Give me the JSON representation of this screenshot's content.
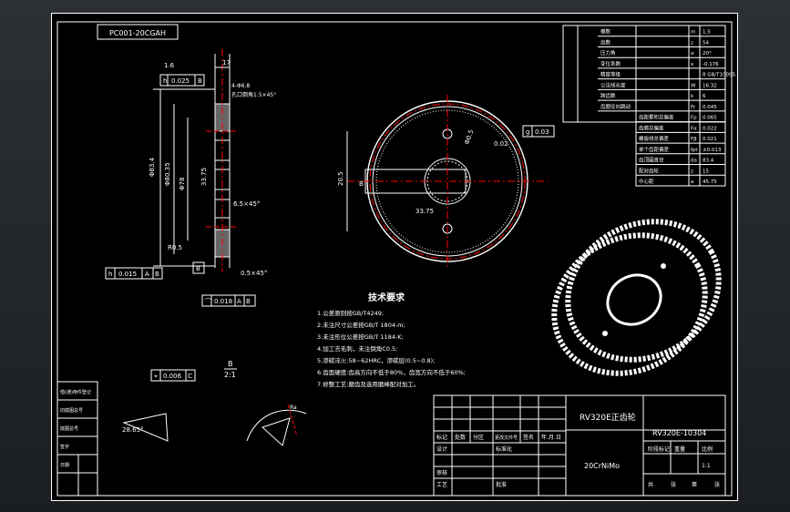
{
  "drawing_number_rotated": "PC001-20CGAH",
  "tech_requirements": {
    "title": "技术要求",
    "lines": [
      "1.公差原则按GB/T4249;",
      "2.未注尺寸公差按GB/T 1804-m;",
      "3.未注形位公差按GB/T 1184-K;",
      "4.加工去毛刺，未注倒角C0.5;",
      "5.渗碳淬火:58~62HRC，渗碳层(0.5~0.8);",
      "6.齿面硬度:齿高方向不低于80%，齿宽方向不低于60%;",
      "7.修整工艺:磨齿及选用磨棒配对加工。"
    ]
  },
  "title_block": {
    "part_name": "RV320E正齿轮",
    "drawing_code": "RV320E-10304",
    "material": "20CrNiMo",
    "scale": "1:1",
    "row_labels": [
      "标记",
      "处数",
      "分区",
      "更改文件号",
      "签名",
      "年.月.日"
    ],
    "labels": [
      "设计",
      "标准化",
      "审核",
      "工艺",
      "批准",
      "阶段标记",
      "重量",
      "比例"
    ],
    "sheets": [
      "共",
      "张",
      "第",
      "张"
    ]
  },
  "left_strip": [
    "借(通)用件登记",
    "旧底图总号",
    "底图总号",
    "签字",
    "日期"
  ],
  "gear_params": {
    "rows": [
      [
        "模数",
        "m",
        "1.5"
      ],
      [
        "齿数",
        "z",
        "54"
      ],
      [
        "压力角",
        "α",
        "20°"
      ],
      [
        "变位系数",
        "x",
        "-0.176"
      ],
      [
        "精度等级",
        "",
        "8 GB/T10095.1"
      ],
      [
        "公法线长度",
        "W",
        "16.32"
      ],
      [
        "跨齿数",
        "k",
        "6"
      ],
      [
        "齿圈径向跳动",
        "Fr",
        "0.045"
      ],
      [
        "齿距累积总偏差",
        "Fp",
        "0.065"
      ],
      [
        "齿廓总偏差",
        "Fα",
        "0.022"
      ],
      [
        "螺旋线总偏差",
        "Fβ",
        "0.021"
      ],
      [
        "单个齿距偏差",
        "fpt",
        "±0.013"
      ],
      [
        "齿顶圆直径",
        "da",
        "83.4"
      ],
      [
        "配对齿轮",
        "z",
        "15"
      ],
      [
        "中心距",
        "a",
        "45.75"
      ]
    ]
  },
  "dims": {
    "a": "Φ83.4",
    "b": "Φ80.35",
    "c": "Φ78",
    "d": "17",
    "e": "R0.5",
    "f": "1.6",
    "g": "33.75",
    "h": "20.5",
    "i": "4-Φ6.8",
    "j": "6.5×45°",
    "k": "0.5×45°",
    "l": "B",
    "m": "2:1",
    "n": "28.65°",
    "o": "Φ0.5",
    "p": "孔口倒角1.5×45°"
  },
  "tolerances": {
    "t1": "0.025",
    "t2": "0.015",
    "t3": "0.018",
    "t4": "0.006",
    "t5": "0.03",
    "t6": "0.02"
  }
}
